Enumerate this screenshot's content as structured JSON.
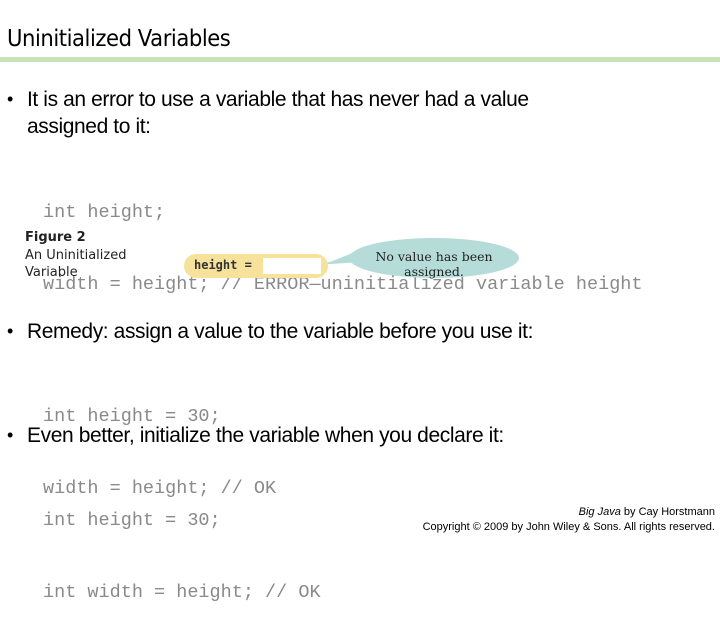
{
  "slide": {
    "title": "Uninitialized Variables",
    "bullets": [
      {
        "text_line1": "It is an error to use a variable that has never had a value",
        "text_line2": "assigned to it:",
        "code": [
          "int height;",
          "width = height; // ERROR—uninitialized variable height"
        ]
      },
      {
        "text_line1": "Remedy: assign a value to the variable before you use it:",
        "code": [
          "int height = 30;",
          "width = height; // OK"
        ]
      },
      {
        "text_line1": "Even better, initialize the variable when you declare it:",
        "code": [
          "int height = 30;",
          "int width = height; // OK"
        ]
      }
    ],
    "bullet_glyph": "•",
    "figure": {
      "number": "Figure 2",
      "caption_line1": "An Uninitialized",
      "caption_line2": "Variable",
      "variable_label": "height =",
      "callout": "No value has been assigned."
    },
    "credit": {
      "book": "Big Java",
      "author": " by Cay Horstmann",
      "copyright": "Copyright © 2009 by John Wiley & Sons.  All rights reserved."
    },
    "colors": {
      "rule": "#c8e3b8",
      "code": "#8a8a8a",
      "pill": "#f7e29c",
      "callout": "#b5dcd9"
    }
  }
}
